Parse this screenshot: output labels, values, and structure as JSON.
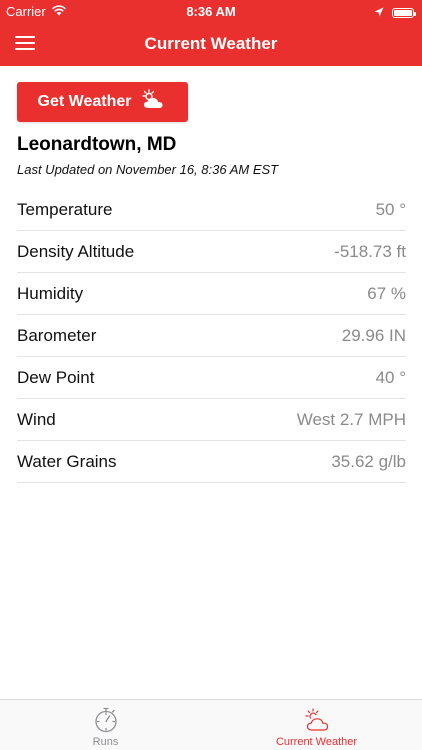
{
  "status_bar": {
    "carrier": "Carrier",
    "time": "8:36 AM"
  },
  "header": {
    "title": "Current Weather"
  },
  "actions": {
    "get_weather_label": "Get Weather"
  },
  "location": {
    "name": "Leonardtown, MD",
    "last_updated": "Last Updated on November 16, 8:36 AM EST"
  },
  "weather_rows": [
    {
      "label": "Temperature",
      "value": "50 °"
    },
    {
      "label": "Density Altitude",
      "value": "-518.73 ft"
    },
    {
      "label": "Humidity",
      "value": "67 %"
    },
    {
      "label": "Barometer",
      "value": "29.96 IN"
    },
    {
      "label": "Dew Point",
      "value": "40 °"
    },
    {
      "label": "Wind",
      "value": "West 2.7 MPH"
    },
    {
      "label": "Water Grains",
      "value": "35.62 g/lb"
    }
  ],
  "tab_bar": {
    "tabs": [
      {
        "label": "Runs",
        "icon": "stopwatch-icon",
        "active": false
      },
      {
        "label": "Current Weather",
        "icon": "partly-cloudy-icon",
        "active": true
      }
    ]
  },
  "colors": {
    "accent": "#ea2f2f",
    "inactive_tab": "#8e8e93",
    "value_text": "#8a8a8a"
  }
}
